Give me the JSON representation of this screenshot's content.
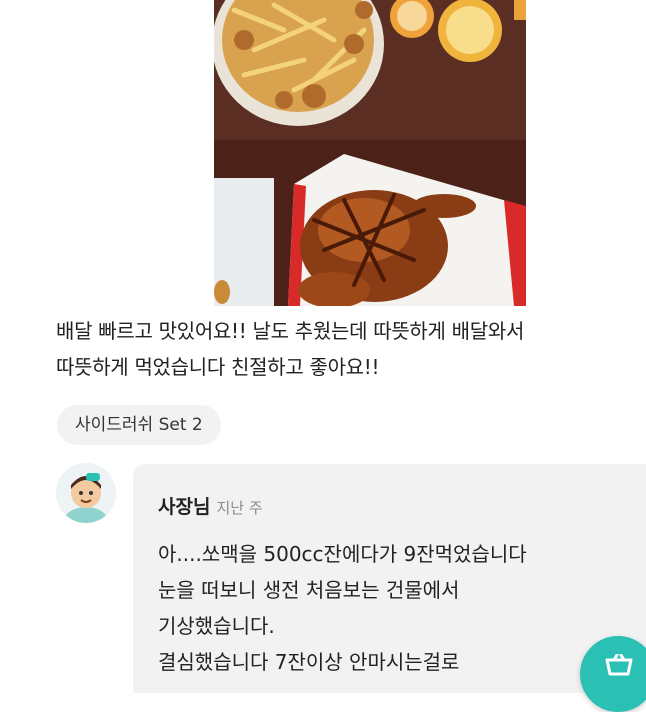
{
  "review": {
    "photo": "food-photo-chicken-fries",
    "text_lines": [
      "배달 빠르고 맛있어요!! 날도 추웠는데 따뜻하게 배달와서",
      "따뜻하게 먹었습니다 친절하고 좋아요!!"
    ],
    "menu_tag": "사이드러쉬 Set  2"
  },
  "owner_reply": {
    "avatar_icon": "owner-avatar-icon",
    "name": "사장님",
    "time": "지난 주",
    "lines": [
      "아....쏘맥을 500cc잔에다가 9잔먹었습니다",
      "눈을 떠보니 생전 처음보는 건물에서",
      "기상했습니다.",
      "결심했습니다 7잔이상 안마시는걸로"
    ]
  },
  "fab": {
    "icon": "cart-icon",
    "color": "#2bc0b4"
  }
}
